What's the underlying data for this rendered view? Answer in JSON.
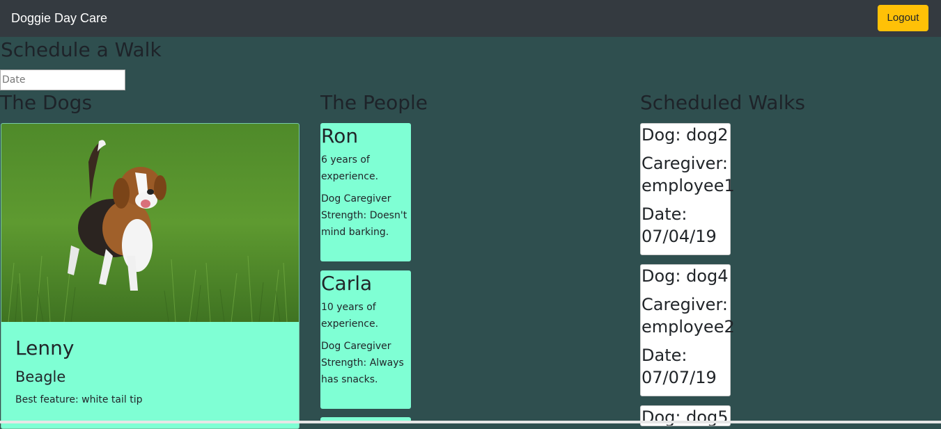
{
  "navbar": {
    "brand": "Doggie Day Care",
    "logout_label": "Logout"
  },
  "schedule": {
    "title": "Schedule a Walk",
    "date_placeholder": "Date"
  },
  "columns": {
    "dogs": "The Dogs",
    "people": "The People",
    "walks": "Scheduled Walks"
  },
  "dogs": [
    {
      "name": "Lenny",
      "breed": "Beagle",
      "feature": "Best feature: white tail tip"
    }
  ],
  "people": [
    {
      "name": "Ron",
      "experience": "6 years of experience.",
      "strength": "Dog Caregiver Strength: Doesn't mind barking."
    },
    {
      "name": "Carla",
      "experience": "10 years of experience.",
      "strength": "Dog Caregiver Strength: Always has snacks."
    }
  ],
  "walks": [
    {
      "dog": "Dog: dog2",
      "caregiver": "Caregiver: employee1",
      "date": "Date: 07/04/19"
    },
    {
      "dog": "Dog: dog4",
      "caregiver": "Caregiver: employee2",
      "date": "Date: 07/07/19"
    },
    {
      "dog": "Dog: dog5"
    }
  ],
  "colors": {
    "page_background": "#2f4f4f",
    "navbar": "#343a40",
    "logout_button": "#ffc107",
    "card_accent": "#7fffd4"
  }
}
